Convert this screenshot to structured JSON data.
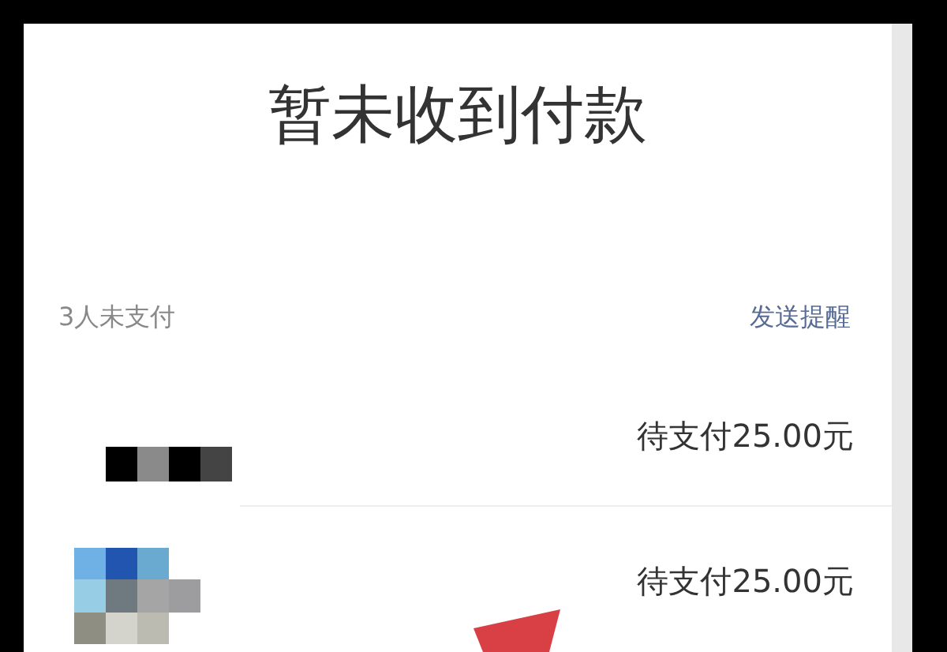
{
  "title": "暂未收到付款",
  "summary": {
    "count_text": "3人未支付",
    "action": "发送提醒"
  },
  "rows": [
    {
      "amount": "待支付25.00元"
    },
    {
      "amount": "待支付25.00元"
    }
  ]
}
